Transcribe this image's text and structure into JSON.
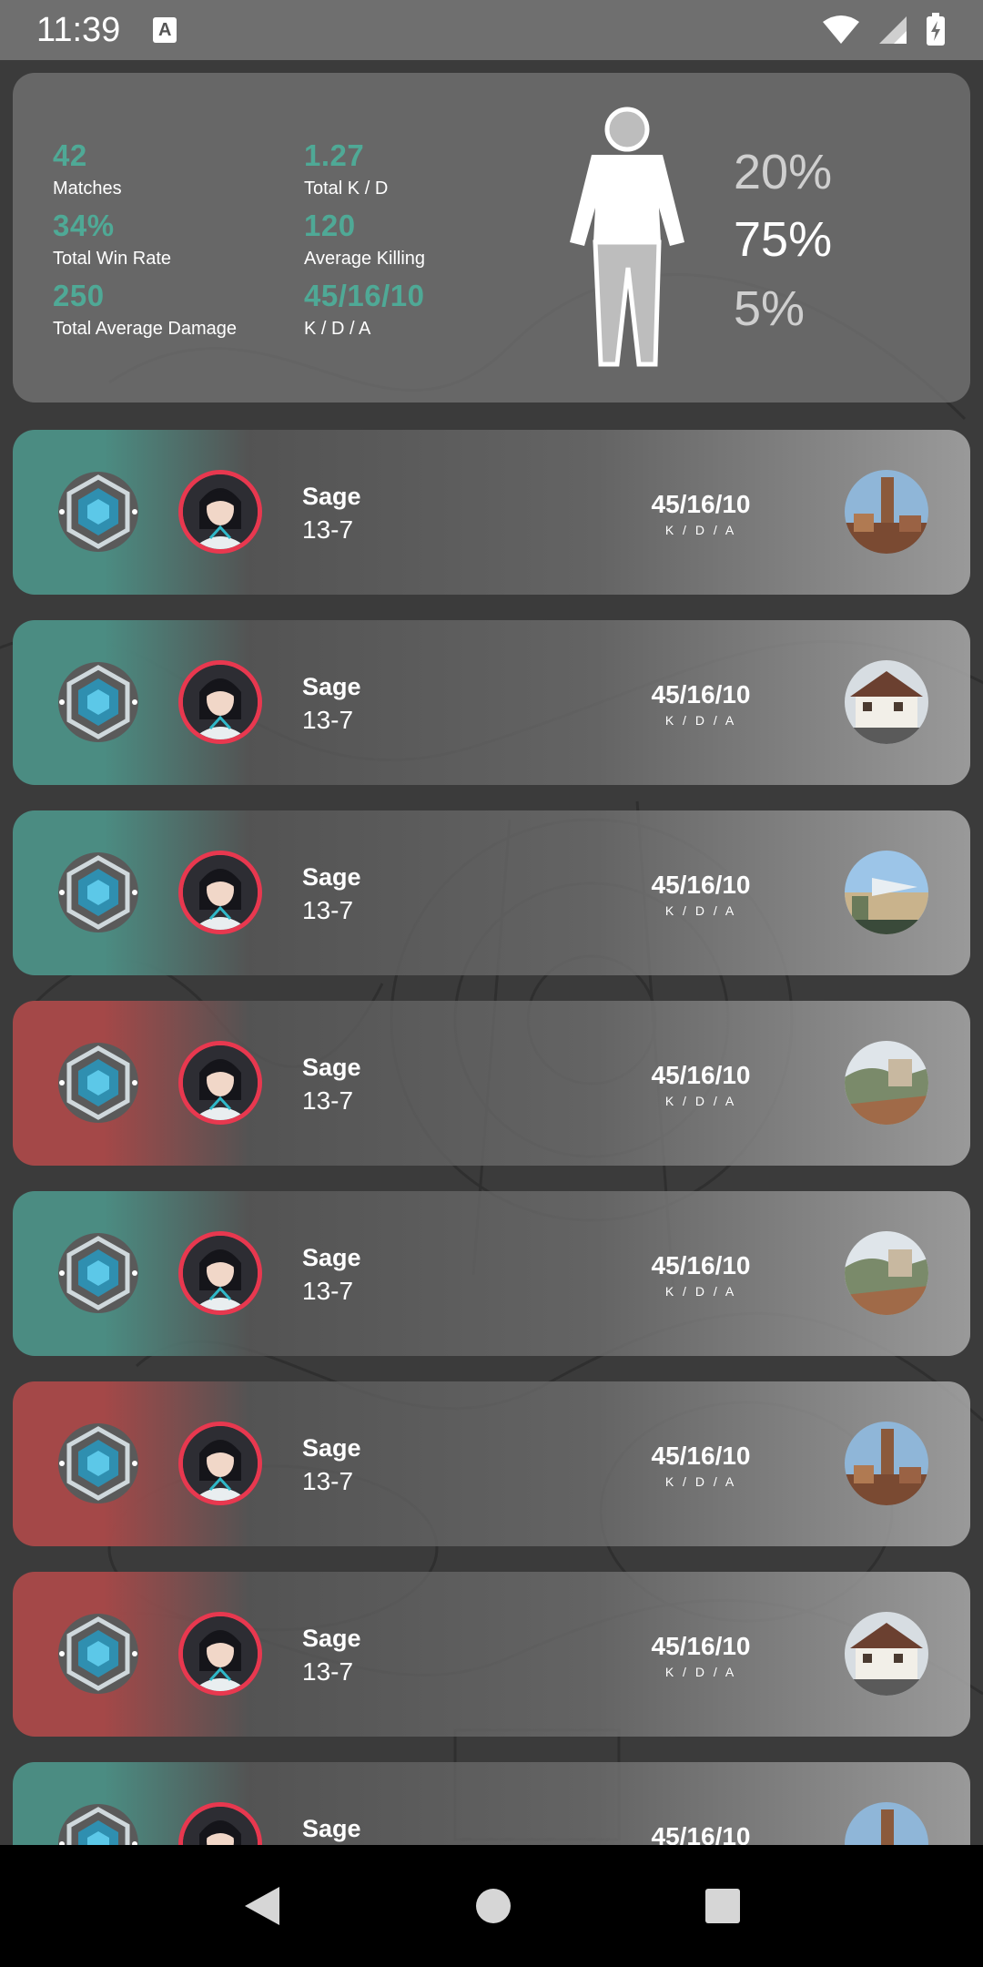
{
  "status_bar": {
    "time": "11:39",
    "notification_icon": "a-icon",
    "icons": [
      "wifi-icon",
      "signal-icon",
      "battery-charging-icon"
    ]
  },
  "summary": {
    "stats": [
      {
        "value": "42",
        "label": "Matches"
      },
      {
        "value": "1.27",
        "label": "Total K / D"
      },
      {
        "value": "34%",
        "label": "Total Win Rate"
      },
      {
        "value": "120",
        "label": "Average Killing"
      },
      {
        "value": "250",
        "label": "Total Average Damage"
      },
      {
        "value": "45/16/10",
        "label": "K / D / A"
      }
    ],
    "body_percentages": [
      "20%",
      "75%",
      "5%"
    ],
    "accent_color": "#4fa996"
  },
  "matches": [
    {
      "agent": "Sage",
      "score": "13-7",
      "kda": "45/16/10",
      "kda_label": "K / D / A",
      "result": "win",
      "map_thumb": "tower-map"
    },
    {
      "agent": "Sage",
      "score": "13-7",
      "kda": "45/16/10",
      "kda_label": "K / D / A",
      "result": "win",
      "map_thumb": "house-map"
    },
    {
      "agent": "Sage",
      "score": "13-7",
      "kda": "45/16/10",
      "kda_label": "K / D / A",
      "result": "win",
      "map_thumb": "beach-map"
    },
    {
      "agent": "Sage",
      "score": "13-7",
      "kda": "45/16/10",
      "kda_label": "K / D / A",
      "result": "loss",
      "map_thumb": "cliff-map"
    },
    {
      "agent": "Sage",
      "score": "13-7",
      "kda": "45/16/10",
      "kda_label": "K / D / A",
      "result": "win",
      "map_thumb": "cliff-map"
    },
    {
      "agent": "Sage",
      "score": "13-7",
      "kda": "45/16/10",
      "kda_label": "K / D / A",
      "result": "loss",
      "map_thumb": "tower-map"
    },
    {
      "agent": "Sage",
      "score": "13-7",
      "kda": "45/16/10",
      "kda_label": "K / D / A",
      "result": "loss",
      "map_thumb": "house-map"
    },
    {
      "agent": "Sage",
      "score": "",
      "kda": "45/16/10",
      "kda_label": "",
      "result": "win",
      "map_thumb": "tower-map"
    }
  ],
  "colors": {
    "win": "#4b8c82",
    "loss": "#a44848",
    "agent_ring": "#e8384f"
  },
  "nav_bar": {
    "icons": [
      "back-icon",
      "home-icon",
      "recents-icon"
    ]
  }
}
